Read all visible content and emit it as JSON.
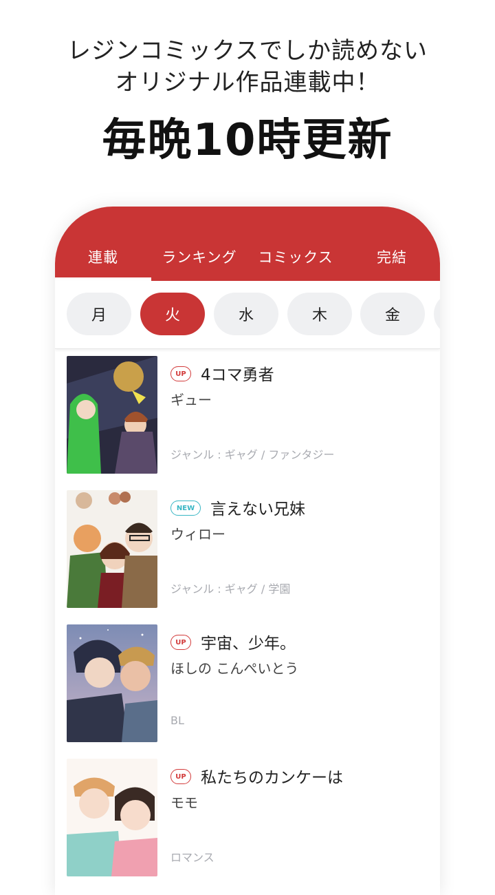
{
  "promo": {
    "line1": "レジンコミックスでしか読めない",
    "line2": "オリジナル作品連載中！",
    "headline": "毎晩10時更新"
  },
  "tabs": [
    {
      "label": "連載"
    },
    {
      "label": "ランキング"
    },
    {
      "label": "コミックス"
    },
    {
      "label": "完結"
    }
  ],
  "active_tab": "連載",
  "days": [
    "月",
    "火",
    "水",
    "木",
    "金"
  ],
  "active_day": "火",
  "colors": {
    "accent": "#c93535",
    "up_badge": "#d23a3a",
    "new_badge": "#38b6c4"
  },
  "comics": [
    {
      "badge": "UP",
      "title": "4コマ勇者",
      "author": "ギュー",
      "genre": "ジャンル : ギャグ / ファンタジー"
    },
    {
      "badge": "NEW",
      "title": "言えない兄妹",
      "author": "ウィロー",
      "genre": "ジャンル : ギャグ / 学園"
    },
    {
      "badge": "UP",
      "title": "宇宙、少年。",
      "author": "ほしの こんぺいとう",
      "genre": "BL"
    },
    {
      "badge": "UP",
      "title": "私たちのカンケーは",
      "author": "モモ",
      "genre": "ロマンス"
    }
  ]
}
